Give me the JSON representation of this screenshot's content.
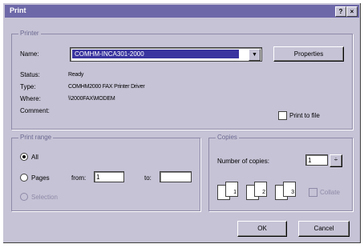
{
  "window": {
    "title": "Print",
    "help_glyph": "?",
    "close_glyph": "×"
  },
  "printer": {
    "legend": "Printer",
    "name_label": "Name:",
    "name_value": "COMHM-INCA301-2000",
    "properties_label": "Properties",
    "status_label": "Status:",
    "status_value": "Ready",
    "type_label": "Type:",
    "type_value": "COMHM2000 FAX Printer Driver",
    "where_label": "Where:",
    "where_value": "\\\\2000FAX\\MODEM",
    "comment_label": "Comment:",
    "print_to_file_label": "Print to file"
  },
  "print_range": {
    "legend": "Print range",
    "all_label": "All",
    "pages_label": "Pages",
    "from_label": "from:",
    "from_value": "1",
    "to_label": "to:",
    "to_value": "",
    "selection_label": "Selection"
  },
  "copies": {
    "legend": "Copies",
    "number_label": "Number of copies:",
    "number_value": "1",
    "collate_label": "Collate",
    "pages": [
      "1",
      "2",
      "3"
    ]
  },
  "buttons": {
    "ok": "OK",
    "cancel": "Cancel"
  }
}
